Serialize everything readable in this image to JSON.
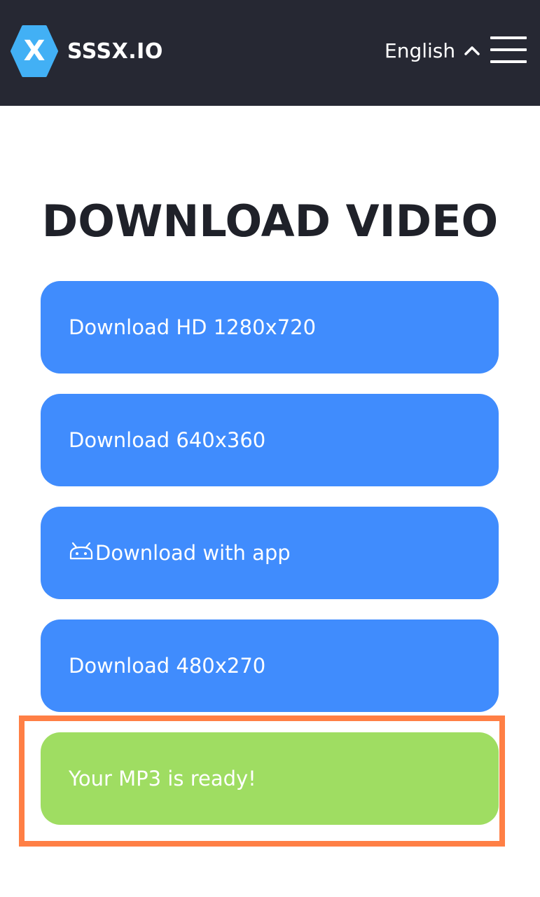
{
  "header": {
    "logo_letter": "X",
    "brand": "SSSX.IO",
    "language": "English"
  },
  "main": {
    "title": "DOWNLOAD VIDEO",
    "buttons": [
      {
        "label": "Download HD 1280x720"
      },
      {
        "label": "Download 640x360"
      },
      {
        "label": "Download with app",
        "icon": "android-icon"
      },
      {
        "label": "Download 480x270"
      },
      {
        "label": "Your MP3 is ready!"
      }
    ]
  },
  "colors": {
    "header_bg": "#262833",
    "logo_blue": "#42b0f5",
    "button_blue": "#408cfd",
    "button_green": "#9fdd62",
    "highlight_orange": "#ff7f45"
  }
}
